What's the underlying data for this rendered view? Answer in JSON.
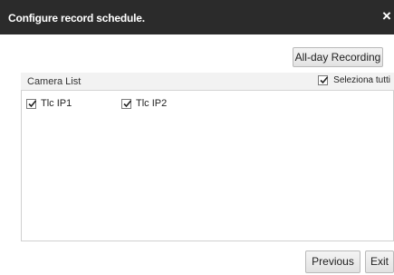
{
  "dialog": {
    "title": "Configure record schedule.",
    "close_label": "×"
  },
  "toolbar": {
    "allday_label": "All-day Recording"
  },
  "camera_list": {
    "header": "Camera List",
    "select_all_label": "Seleziona tutti",
    "select_all_checked": true,
    "cameras": [
      {
        "label": "Tlc IP1",
        "checked": true
      },
      {
        "label": "Tlc IP2",
        "checked": true
      }
    ]
  },
  "footer": {
    "previous_label": "Previous",
    "exit_label": "Exit"
  }
}
